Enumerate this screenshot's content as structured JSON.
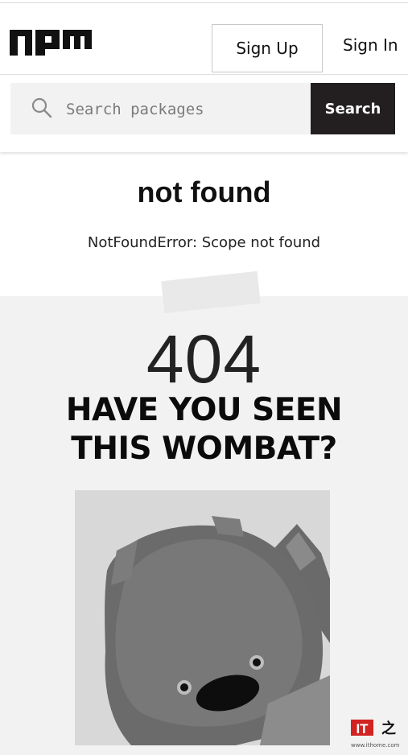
{
  "header": {
    "logo_alt": "npm",
    "sign_up_label": "Sign Up",
    "sign_in_label": "Sign In"
  },
  "search": {
    "placeholder": "Search packages",
    "button_label": "Search"
  },
  "error": {
    "title": "not found",
    "message": "NotFoundError: Scope not found"
  },
  "wombat": {
    "code": "404",
    "headline_line1": "HAVE YOU SEEN",
    "headline_line2": "THIS WOMBAT?"
  },
  "watermark": {
    "brand": "IT之家",
    "url": "www.ithome.com"
  },
  "colors": {
    "search_button": "#231f20",
    "field_bg": "#f2f2f2",
    "section_bg": "#f2f2f2",
    "watermark_red": "#d22222"
  }
}
